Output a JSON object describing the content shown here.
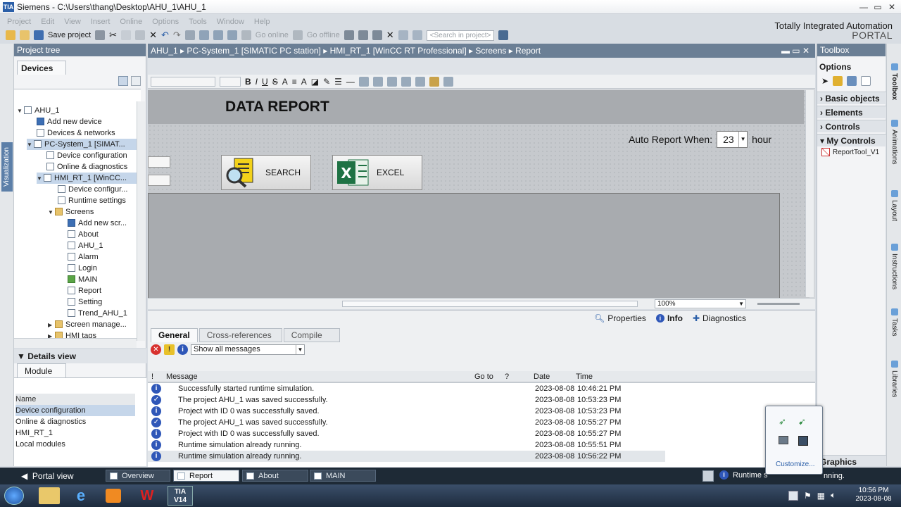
{
  "window": {
    "title": "Siemens - C:\\Users\\thang\\Desktop\\AHU_1\\AHU_1",
    "brand_line1": "Totally Integrated Automation",
    "brand_line2": "PORTAL"
  },
  "menu": [
    "Project",
    "Edit",
    "View",
    "Insert",
    "Online",
    "Options",
    "Tools",
    "Window",
    "Help"
  ],
  "toolbar": {
    "save_label": "Save project",
    "go_online": "Go online",
    "go_offline": "Go offline",
    "search_placeholder": "<Search in project>"
  },
  "left_vertical_tab": "Visualization",
  "project_tree": {
    "title": "Project tree",
    "tab": "Devices",
    "items": [
      {
        "label": "AHU_1"
      },
      {
        "label": "Add new device"
      },
      {
        "label": "Devices & networks"
      },
      {
        "label": "PC-System_1 [SIMAT..."
      },
      {
        "label": "Device configuration"
      },
      {
        "label": "Online & diagnostics"
      },
      {
        "label": "HMI_RT_1 [WinCC..."
      },
      {
        "label": "Device configur..."
      },
      {
        "label": "Runtime settings"
      },
      {
        "label": "Screens"
      },
      {
        "label": "Add new scr..."
      },
      {
        "label": "About"
      },
      {
        "label": "AHU_1"
      },
      {
        "label": "Alarm"
      },
      {
        "label": "Login"
      },
      {
        "label": "MAIN"
      },
      {
        "label": "Report"
      },
      {
        "label": "Setting"
      },
      {
        "label": "Trend_AHU_1"
      },
      {
        "label": "Screen manage..."
      },
      {
        "label": "HMI tags"
      }
    ]
  },
  "details_view": {
    "title": "Details view",
    "tab": "Module",
    "column": "Name",
    "items": [
      "Device configuration",
      "Online & diagnostics",
      "HMI_RT_1",
      "Local modules"
    ]
  },
  "breadcrumb": [
    "AHU_1",
    "PC-System_1 [SIMATIC PC station]",
    "HMI_RT_1 [WinCC RT Professional]",
    "Screens",
    "Report"
  ],
  "screen": {
    "title": "DATA REPORT",
    "auto_report_label": "Auto Report When:",
    "auto_report_value": "23",
    "auto_report_unit": "hour",
    "search_button": "SEARCH",
    "excel_button": "EXCEL",
    "zoom": "100%"
  },
  "inspector": {
    "tabs": [
      "Properties",
      "Info",
      "Diagnostics"
    ],
    "subtabs": [
      "General",
      "Cross-references",
      "Compile"
    ],
    "filter": "Show all messages",
    "columns": [
      "!",
      "Message",
      "Go to",
      "?",
      "Date",
      "Time"
    ],
    "messages": [
      {
        "text": "Successfully started runtime simulation.",
        "date": "2023-08-08",
        "time": "10:46:21 PM"
      },
      {
        "text": "The project AHU_1 was saved successfully.",
        "date": "2023-08-08",
        "time": "10:53:23 PM"
      },
      {
        "text": "Project with ID 0 was successfully saved.",
        "date": "2023-08-08",
        "time": "10:53:23 PM"
      },
      {
        "text": "The project AHU_1 was saved successfully.",
        "date": "2023-08-08",
        "time": "10:55:27 PM"
      },
      {
        "text": "Project with ID 0 was successfully saved.",
        "date": "2023-08-08",
        "time": "10:55:27 PM"
      },
      {
        "text": "Runtime simulation already running.",
        "date": "2023-08-08",
        "time": "10:55:51 PM"
      },
      {
        "text": "Runtime simulation already running.",
        "date": "2023-08-08",
        "time": "10:56:22 PM"
      }
    ]
  },
  "toolbox": {
    "title": "Toolbox",
    "options": "Options",
    "sections": [
      "Basic objects",
      "Elements",
      "Controls",
      "My Controls"
    ],
    "my_control_item": "ReportTool_V1",
    "graphics": "Graphics"
  },
  "right_tabs": [
    "Toolbox",
    "Animations",
    "Layout",
    "Instructions",
    "Tasks",
    "Libraries"
  ],
  "bottom_bar": {
    "portal_view": "Portal view",
    "tabs": [
      "Overview",
      "Report",
      "About",
      "MAIN"
    ],
    "status_text": "Runtime s",
    "status_tail": "nning."
  },
  "tray": {
    "customize": "Customize...",
    "time": "10:56 PM",
    "date": "2023-08-08"
  },
  "taskbar_app": "TIA V14"
}
